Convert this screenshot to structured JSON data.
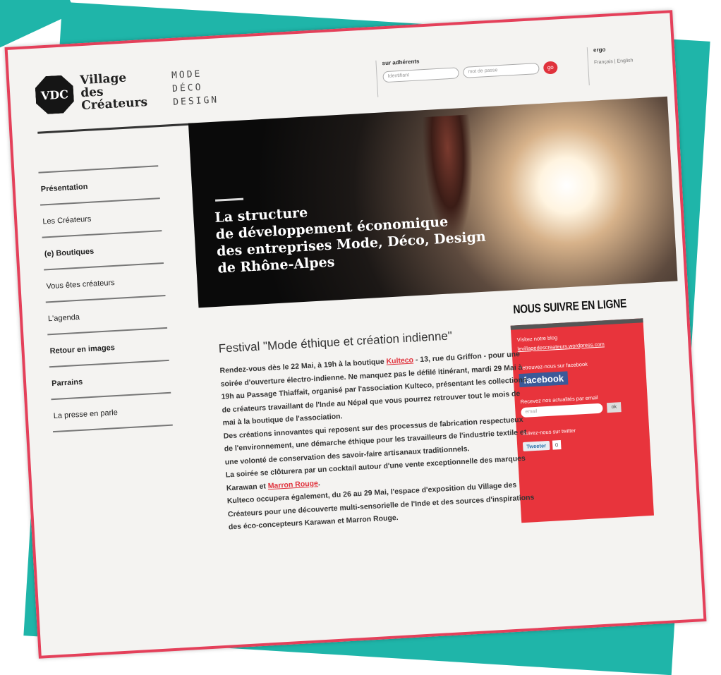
{
  "colors": {
    "accent": "#e4405a",
    "teal": "#1fb5a9",
    "follow_box": "#e8343c",
    "facebook": "#3b5998"
  },
  "logo": "VDC",
  "brand": [
    "Village",
    "des",
    "Créateurs"
  ],
  "categories": [
    "MODE",
    "DÉCO",
    "DESIGN"
  ],
  "search": {
    "label": "sur adhérents",
    "placeholder_1": "Identifiant",
    "placeholder_2": "mot de passe",
    "go": "go"
  },
  "lang": {
    "title": "ergo",
    "options": "Français | English"
  },
  "nav": [
    "Présentation",
    "Les Créateurs",
    "(e) Boutiques",
    "Vous êtes créateurs",
    "L'agenda",
    "Retour en images",
    "Parrains",
    "La presse en parle"
  ],
  "hero": {
    "lines": [
      "La structure",
      "de développement économique",
      "des entreprises Mode, Déco, Design",
      "de Rhône-Alpes"
    ]
  },
  "follow": {
    "title": "NOUS SUIVRE EN LIGNE",
    "blog_label": "Visitez notre blog",
    "blog_link": "levillagedescreateurs.wordpress.com",
    "facebook_label": "Retrouvez-nous sur facebook",
    "facebook_button": "facebook",
    "email_label": "Recevez nos actualités par email",
    "email_placeholder": "email",
    "email_ok": "ok",
    "twitter_label": "Suivez-nous sur twitter",
    "tweet_button": "Tweeter",
    "tweet_count": "0"
  },
  "article": {
    "title": "Festival \"Mode éthique et création indienne\"",
    "p1_a": "Rendez-vous dès le 22 Mai, à 19h à la boutique ",
    "p1_link": "Kulteco",
    "p1_b": " - 13, rue du Griffon - pour une soirée d'ouverture électro-indienne. Ne manquez pas le défilé itinérant, mardi 29 Mai à 19h au Passage Thiaffait, organisé par l'association Kulteco, présentant les collections de créateurs travaillant de l'Inde au Népal que vous pourrez retrouver tout le mois de mai à la boutique de l'association.",
    "p2": "Des créations innovantes qui reposent sur des processus de fabrication respectueux de l'environnement, une démarche éthique pour les travailleurs de l'industrie textile et une volonté de conservation des savoir-faire artisanaux traditionnels.",
    "p3_a": "La soirée se clôturera par un cocktail autour d'une vente exceptionnelle des marques Karawan et ",
    "p3_link": "Marron Rouge",
    "p3_b": ".",
    "p4": "Kulteco occupera également, du 26 au 29 Mai, l'espace d'exposition du Village des Créateurs pour une découverte multi-sensorielle de l'Inde et des sources d'inspirations des éco-concepteurs Karawan et Marron Rouge."
  }
}
